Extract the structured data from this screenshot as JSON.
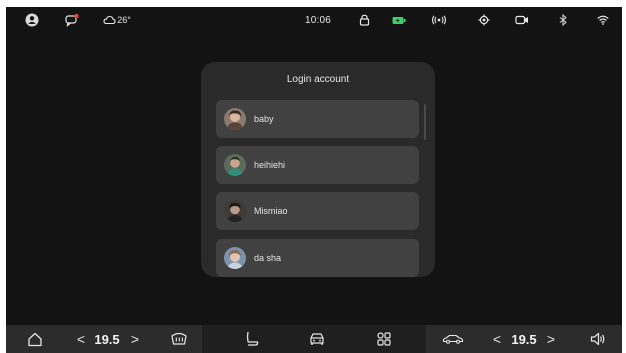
{
  "status_bar": {
    "weather_temp": "26°",
    "time": "10:06",
    "icons": [
      "user-icon",
      "message-badge-icon",
      "cloud-icon",
      "lock-icon",
      "battery-icon",
      "broadcast-icon",
      "location-target-icon",
      "camera-icon",
      "bluetooth-icon",
      "wifi-icon"
    ],
    "battery_color": "#3ecf6a",
    "notification_badge_color": "#e8453c"
  },
  "login_dialog": {
    "title": "Login account",
    "accounts": [
      {
        "name": "baby",
        "avatar": "avatar-icon"
      },
      {
        "name": "heihiehi",
        "avatar": "avatar-icon"
      },
      {
        "name": "Mismiao",
        "avatar": "avatar-icon"
      },
      {
        "name": "da sha",
        "avatar": "avatar-icon"
      }
    ]
  },
  "dock": {
    "left_temp": "19.5",
    "right_temp": "19.5",
    "prev_glyph": "<",
    "next_glyph": ">",
    "icons": [
      "home-icon",
      "defrost-icon",
      "seat-icon",
      "car-icon",
      "apps-grid-icon",
      "car-side-icon",
      "volume-icon"
    ]
  }
}
